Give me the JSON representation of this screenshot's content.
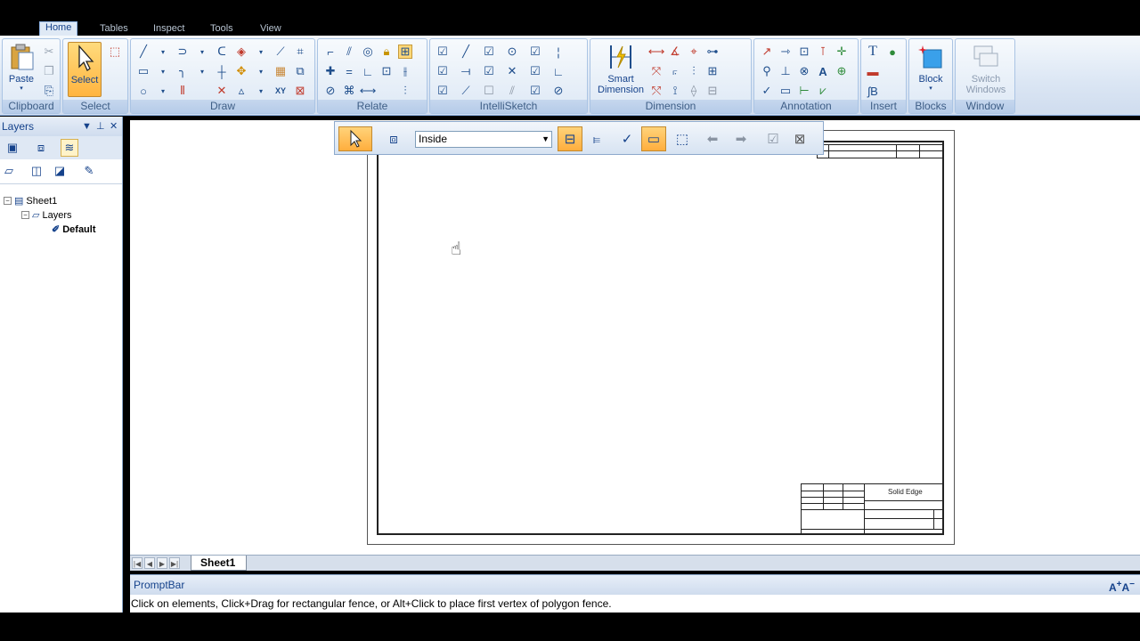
{
  "tabs": [
    {
      "label": "Home",
      "active": true
    },
    {
      "label": "Tables",
      "active": false
    },
    {
      "label": "Inspect",
      "active": false
    },
    {
      "label": "Tools",
      "active": false
    },
    {
      "label": "View",
      "active": false
    }
  ],
  "ribbon": {
    "groups": {
      "clipboard": "Clipboard",
      "select": "Select",
      "draw": "Draw",
      "relate": "Relate",
      "intellisketch": "IntelliSketch",
      "dimension": "Dimension",
      "annotation": "Annotation",
      "insert": "Insert",
      "blocks": "Blocks",
      "window": "Window"
    },
    "buttons": {
      "paste": "Paste",
      "select": "Select",
      "smart_dimension_1": "Smart",
      "smart_dimension_2": "Dimension",
      "block": "Block",
      "switch_windows_1": "Switch",
      "switch_windows_2": "Windows"
    }
  },
  "left_panel": {
    "title": "Layers",
    "tree": {
      "sheet": "Sheet1",
      "layers": "Layers",
      "default": "Default"
    }
  },
  "select_toolbar": {
    "fence_mode": "Inside"
  },
  "drawing": {
    "title_brand": "Solid Edge"
  },
  "sheet_tabs": {
    "active": "Sheet1"
  },
  "prompt_bar": {
    "title": "PromptBar",
    "message": "Click on elements, Click+Drag for rectangular fence, or Alt+Click to place first vertex of polygon fence."
  },
  "colors": {
    "ribbon_bg": "#dbe6f4",
    "accent_orange": "#ffb43f",
    "label_blue": "#15428b"
  }
}
